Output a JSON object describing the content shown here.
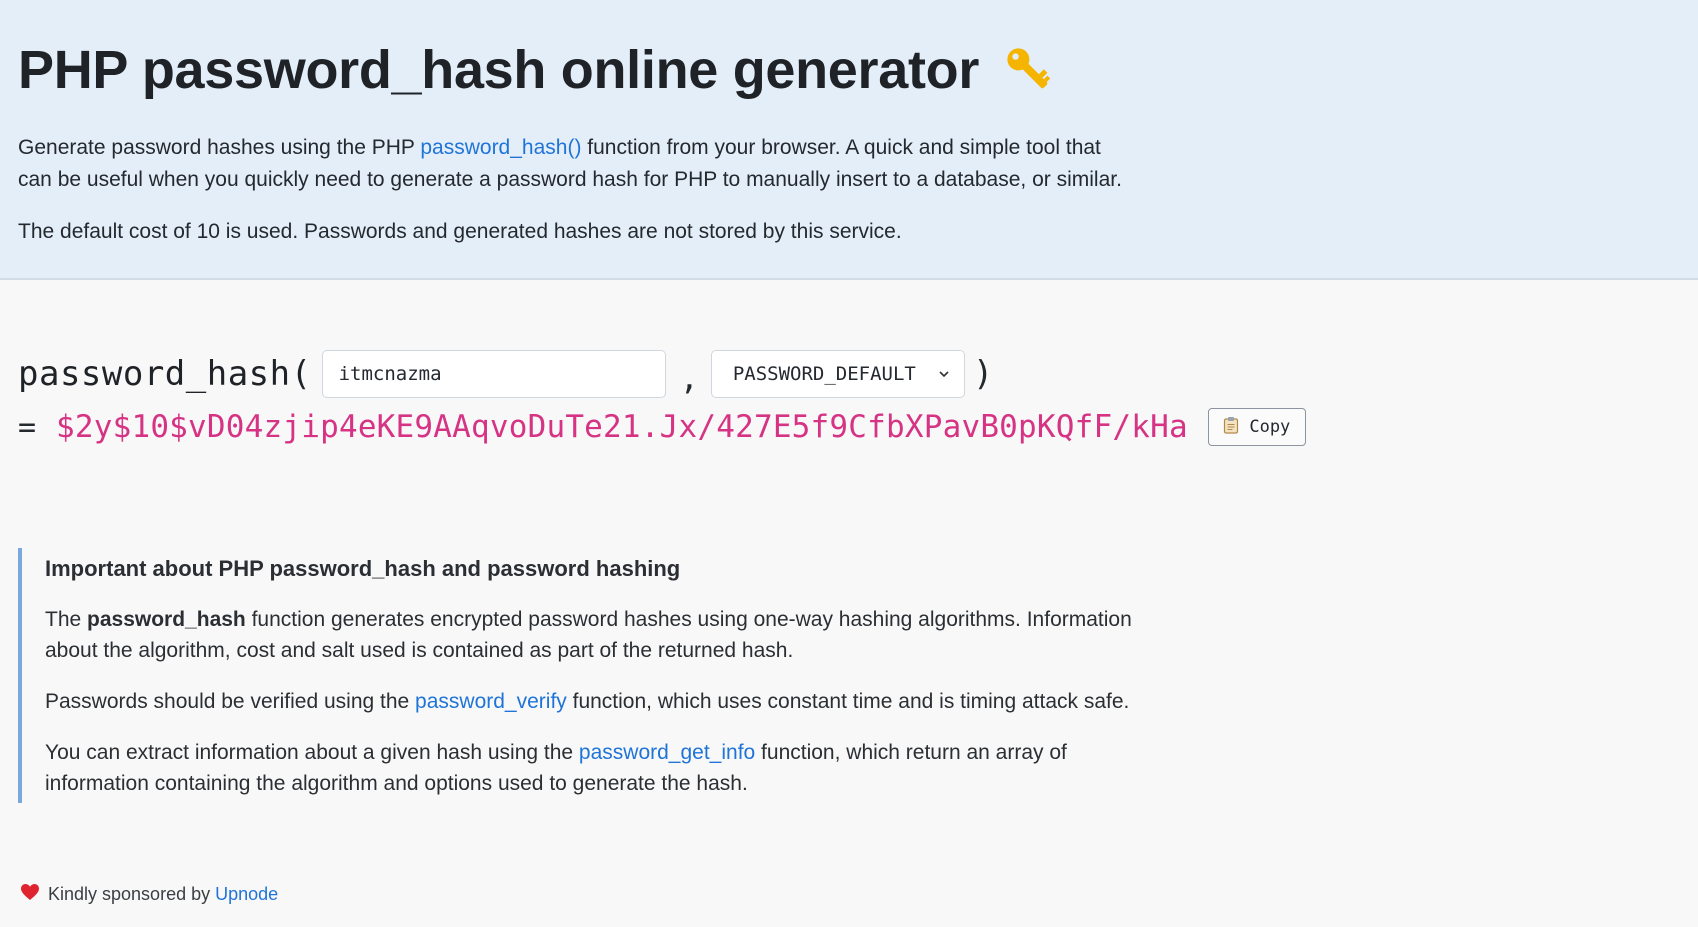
{
  "hero": {
    "title": "PHP password_hash online generator",
    "title_icon": "key-icon",
    "intro_before_link": "Generate password hashes using the PHP ",
    "intro_link": "password_hash()",
    "intro_after_link": " function from your browser. A quick and simple tool that can be useful when you quickly need to generate a password hash for PHP to manually insert to a database, or similar.",
    "cost_note": "The default cost of 10 is used. Passwords and generated hashes are not stored by this service."
  },
  "tool": {
    "function_open": "password_hash(",
    "password_value": "itmcnazma",
    "comma": ",",
    "algorithm_selected": "PASSWORD_DEFAULT",
    "function_close": ")",
    "equals": "=",
    "hash_output": "$2y$10$vD04zjip4eKE9AAqvoDuTe21.Jx/427E5f9CfbXPavB0pKQfF/kHa",
    "copy_label": "Copy"
  },
  "note": {
    "heading": "Important about PHP password_hash and password hashing",
    "p1_before": "The ",
    "p1_bold": "password_hash",
    "p1_after": " function generates encrypted password hashes using one-way hashing algorithms. Information about the algorithm, cost and salt used is contained as part of the returned hash.",
    "p2_before": "Passwords should be verified using the ",
    "p2_link": "password_verify",
    "p2_after": " function, which uses constant time and is timing attack safe.",
    "p3_before": "You can extract information about a given hash using the ",
    "p3_link": "password_get_info",
    "p3_after": " function, which return an array of information containing the algorithm and options used to generate the hash."
  },
  "footer": {
    "text": "Kindly sponsored by ",
    "link": "Upnode"
  },
  "colors": {
    "hero_bg": "#e4eef8",
    "link": "#1f74d8",
    "hash": "#d63384",
    "note_border": "#7aa7dc"
  }
}
